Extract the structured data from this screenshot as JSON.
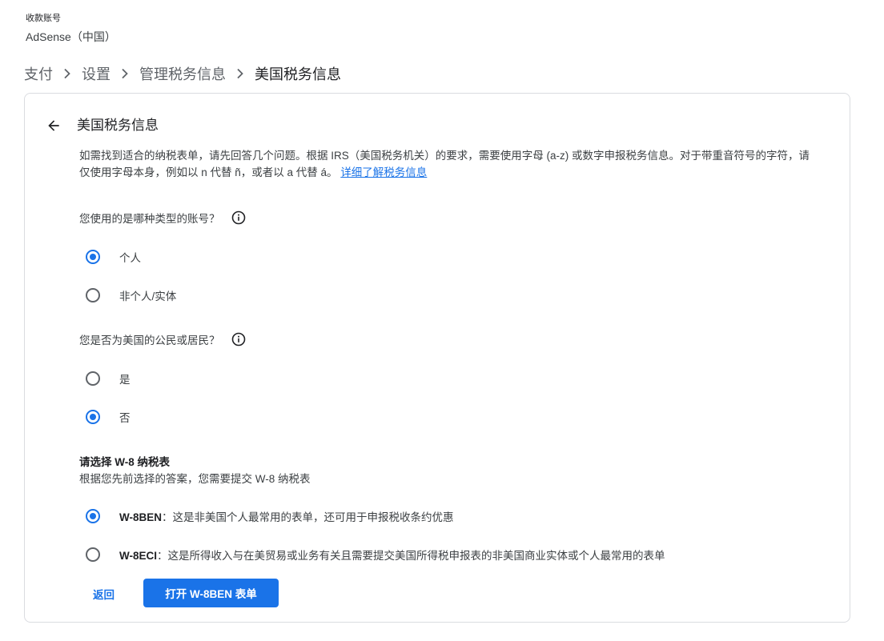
{
  "account": {
    "label": "收款账号",
    "name": "AdSense（中国）"
  },
  "breadcrumb": [
    {
      "label": "支付"
    },
    {
      "label": "设置"
    },
    {
      "label": "管理税务信息"
    },
    {
      "label": "美国税务信息"
    }
  ],
  "card": {
    "title": "美国税务信息",
    "intro_text": "如需找到适合的纳税表单，请先回答几个问题。根据 IRS（美国税务机关）的要求，需要使用字母 (a-z) 或数字申报税务信息。对于带重音符号的字符，请仅使用字母本身，例如以 n 代替 ñ，或者以 a 代替 á。",
    "intro_link": "详细了解税务信息"
  },
  "q1": {
    "question": "您使用的是哪种类型的账号？",
    "options": [
      {
        "label": "个人",
        "checked": true
      },
      {
        "label": "非个人/实体",
        "checked": false
      }
    ]
  },
  "q2": {
    "question": "您是否为美国的公民或居民？",
    "options": [
      {
        "label": "是",
        "checked": false
      },
      {
        "label": "否",
        "checked": true
      }
    ]
  },
  "w8": {
    "title": "请选择 W-8 纳税表",
    "subtitle": "根据您先前选择的答案，您需要提交 W-8 纳税表",
    "options": [
      {
        "code": "W-8BEN",
        "desc": "：这是非美国个人最常用的表单，还可用于申报税收条约优惠",
        "checked": true
      },
      {
        "code": "W-8ECI",
        "desc": "：这是所得收入与在美贸易或业务有关且需要提交美国所得税申报表的非美国商业实体或个人最常用的表单",
        "checked": false
      }
    ]
  },
  "actions": {
    "back_label": "返回",
    "primary_label": "打开 W-8BEN 表单"
  },
  "colors": {
    "accent": "#1a73e8",
    "text": "#202124",
    "secondary_text": "#5f6368",
    "border": "#dadce0"
  },
  "icons": {
    "back": "arrow-back-icon",
    "info": "info-icon",
    "breadcrumb_separator": "chevron-right-icon"
  }
}
